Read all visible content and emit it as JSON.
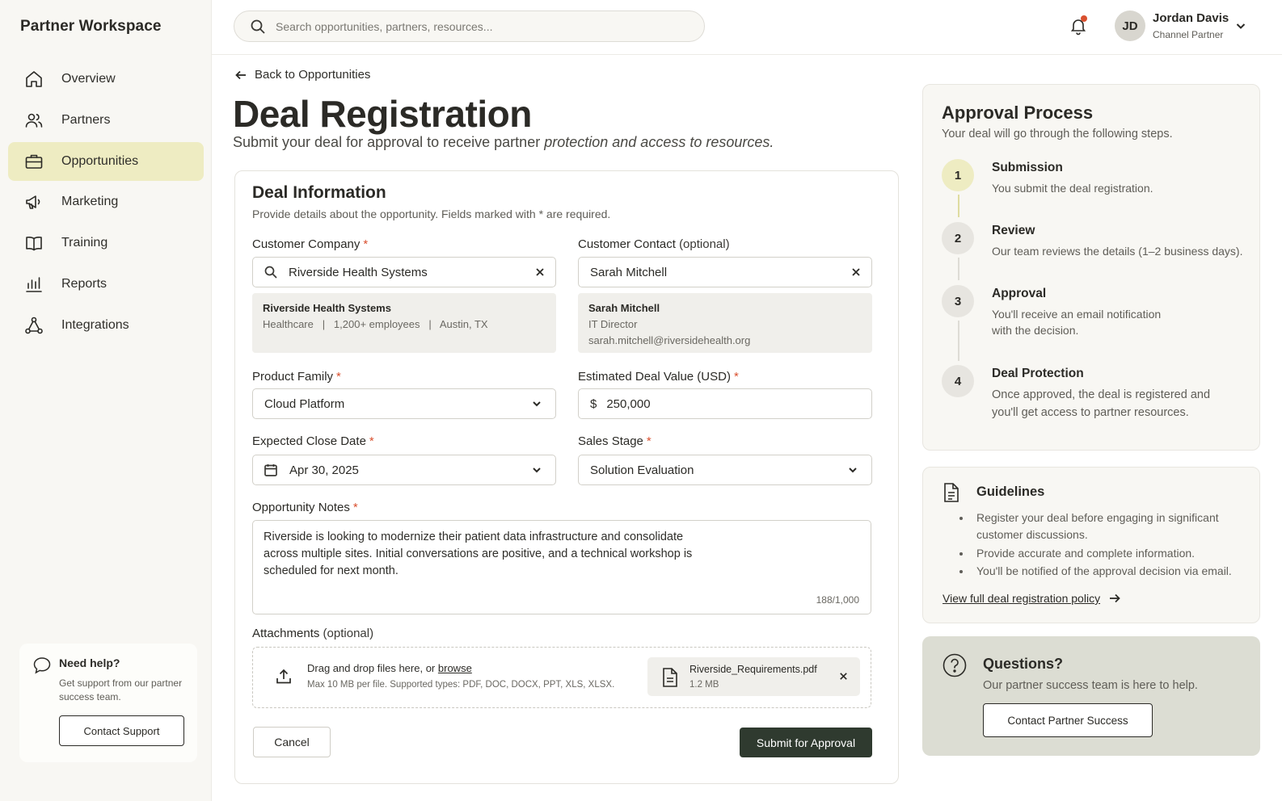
{
  "brand": "Partner Workspace",
  "sidebar": {
    "items": [
      {
        "label": "Overview",
        "icon": "home-icon"
      },
      {
        "label": "Partners",
        "icon": "users-icon"
      },
      {
        "label": "Opportunities",
        "icon": "briefcase-icon",
        "active": true
      },
      {
        "label": "Marketing",
        "icon": "megaphone-icon"
      },
      {
        "label": "Training",
        "icon": "book-icon"
      },
      {
        "label": "Reports",
        "icon": "bar-chart-icon"
      },
      {
        "label": "Integrations",
        "icon": "network-icon"
      }
    ],
    "help": {
      "title": "Need help?",
      "description": "Get support from our partner success team.",
      "button": "Contact Support"
    }
  },
  "topbar": {
    "search_placeholder": "Search opportunities, partners, resources...",
    "user": {
      "initials": "JD",
      "name": "Jordan Davis",
      "role": "Channel Partner"
    }
  },
  "main": {
    "back_label": "Back to Opportunities",
    "title": "Deal Registration",
    "subtitle_plain": "Submit your deal for approval to receive partner",
    "subtitle_italic": "protection and access to resources."
  },
  "form": {
    "title": "Deal Information",
    "subtitle": "Provide details about the opportunity. Fields marked with * are required.",
    "required_mark": "*",
    "customer_company": {
      "label": "Customer Company",
      "value": "Riverside Health Systems",
      "suggestion": {
        "name": "Riverside Health Systems",
        "meta": "Healthcare   |   1,200+ employees   |   Austin, TX"
      }
    },
    "customer_contact": {
      "label": "Customer Contact",
      "optional": "(optional)",
      "value": "Sarah Mitchell",
      "suggestion": {
        "name": "Sarah Mitchell",
        "title": "IT Director",
        "email": "sarah.mitchell@riversidehealth.org"
      }
    },
    "product_family": {
      "label": "Product Family",
      "value": "Cloud Platform"
    },
    "deal_value": {
      "label": "Estimated Deal Value (USD)",
      "currency": "$",
      "value": "250,000"
    },
    "close_date": {
      "label": "Expected Close Date",
      "value": "Apr 30, 2025"
    },
    "sales_stage": {
      "label": "Sales Stage",
      "value": "Solution Evaluation"
    },
    "notes": {
      "label": "Opportunity Notes",
      "value": "Riverside is looking to modernize their patient data infrastructure and consolidate across multiple sites. Initial conversations are positive, and a technical workshop is scheduled for next month.",
      "count": "188/1,000"
    },
    "attachments": {
      "label": "Attachments",
      "optional": "(optional)",
      "drop_text": "Drag and drop files here, or",
      "browse": "browse",
      "drop_meta": "Max 10 MB per file. Supported types: PDF, DOC, DOCX, PPT, XLS, XLSX.",
      "file": {
        "name": "Riverside_Requirements.pdf",
        "size": "1.2 MB"
      }
    },
    "cancel": "Cancel",
    "submit": "Submit for Approval"
  },
  "approval": {
    "title": "Approval Process",
    "subtitle": "Your deal will go through the following steps.",
    "steps": [
      {
        "num": "1",
        "title": "Submission",
        "desc": "You submit the deal registration."
      },
      {
        "num": "2",
        "title": "Review",
        "desc": "Our team reviews the details (1–2 business days)."
      },
      {
        "num": "3",
        "title": "Approval",
        "desc": "You'll receive an email notification with the decision."
      },
      {
        "num": "4",
        "title": "Deal Protection",
        "desc": "Once approved, the deal is registered and you'll get access to partner resources."
      }
    ]
  },
  "guidelines": {
    "title": "Guidelines",
    "items": [
      "Register your deal before engaging in significant customer discussions.",
      "Provide accurate and complete information.",
      "You'll be notified of the approval decision via email."
    ],
    "link": "View full deal registration policy"
  },
  "questions": {
    "title": "Questions?",
    "description": "Our partner success team is here to help.",
    "button": "Contact Partner Success"
  },
  "colors": {
    "accent": "#eeecc2",
    "required": "#d9502f",
    "primary_button": "#2f3a2f",
    "questions_bg": "#dcddd3"
  }
}
